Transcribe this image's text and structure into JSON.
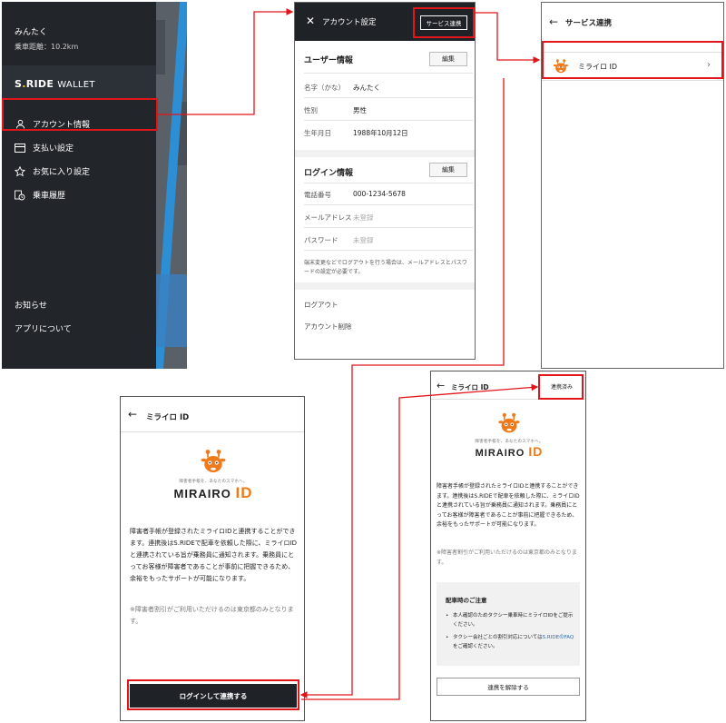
{
  "menu": {
    "user_name": "みんたく",
    "distance": "乗車距離：10.2km",
    "wallet_logo": {
      "s": "S",
      "dot": ".",
      "ride": "RIDE",
      "wallet": "WALLET"
    },
    "items": [
      {
        "label": "アカウント情報",
        "icon": "user-icon"
      },
      {
        "label": "支払い設定",
        "icon": "card-icon"
      },
      {
        "label": "お気に入り設定",
        "icon": "star-icon"
      },
      {
        "label": "乗車履歴",
        "icon": "history-icon"
      }
    ],
    "footer": [
      {
        "label": "お知らせ"
      },
      {
        "label": "アプリについて"
      }
    ]
  },
  "account": {
    "title": "アカウント設定",
    "service_button": "サービス連携",
    "user_section": {
      "title": "ユーザー情報",
      "edit": "編集",
      "rows": [
        {
          "label": "名字（かな）",
          "value": "みんたく"
        },
        {
          "label": "性別",
          "value": "男性"
        },
        {
          "label": "生年月日",
          "value": "1988年10月12日"
        }
      ]
    },
    "login_section": {
      "title": "ログイン情報",
      "edit": "編集",
      "rows": [
        {
          "label": "電話番号",
          "value": "000-1234-5678"
        },
        {
          "label": "メールアドレス",
          "value": "未登録"
        },
        {
          "label": "パスワード",
          "value": "未登録"
        }
      ]
    },
    "note": "端末変更などでログアウトを行う場合は、メールアドレスとパスワードの設定が必要です。",
    "logout": "ログアウト",
    "delete": "アカウント削除"
  },
  "service": {
    "title": "サービス連携",
    "item_label": "ミライロ ID"
  },
  "mirairo_linked": {
    "title": "ミライロ ID",
    "status": "連携済み",
    "logo_tag": "障害者手帳を、あなたのスマホへ。",
    "logo_text": "MIRAIRO",
    "logo_id": "ID",
    "description": "障害者手帳が登録されたミライロIDと連携することができます。連携後はS.RIDEで配車を依頼した際に、ミライロIDと連携されている旨が乗務員に通知されます。乗務員にとってお客様が障害者であることが事前に把握できるため、余裕をもったサポートが可能になります。",
    "note": "※障害者割引がご利用いただけるのは東京都のみとなります。",
    "caution_title": "配車時のご注意",
    "caution_1": "本人確認のためタクシー乗車時にミライロIDをご提示ください。",
    "caution_2_prefix": "タクシー会社ごとの割引対応については",
    "caution_2_link": "S.RIDEのFAQ",
    "caution_2_suffix": "をご確認ください。",
    "unlink_button": "連携を解除する"
  },
  "mirairo_login": {
    "title": "ミライロ ID",
    "logo_tag": "障害者手帳を、あなたのスマホへ。",
    "logo_text": "MIRAIRO",
    "logo_id": "ID",
    "description": "障害者手帳が登録されたミライロIDと連携することができます。連携後はS.RIDEで配車を依頼した際に、ミライロIDと連携されている旨が乗務員に通知されます。乗務員にとってお客様が障害者であることが事前に把握できるため、余裕をもったサポートが可能になります。",
    "note": "※障害者割引がご利用いただけるのは東京都のみとなります。",
    "login_button": "ログインして連携する"
  },
  "colors": {
    "dark": "#1f2328",
    "highlight": "#e2151b",
    "mirairo_orange": "#f07a1a",
    "link": "#2a6db5"
  }
}
